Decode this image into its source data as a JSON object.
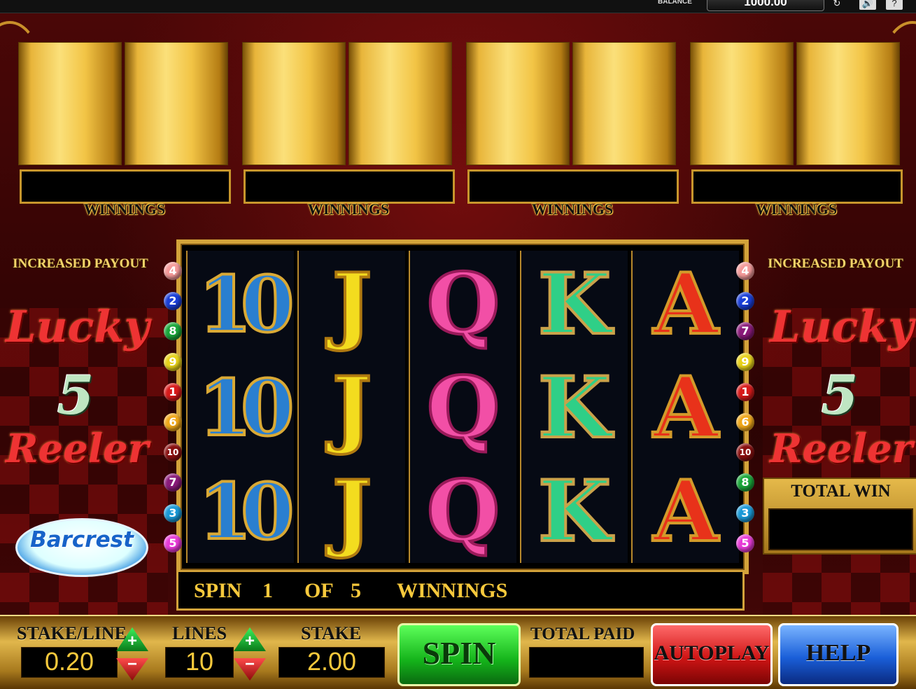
{
  "topbar": {
    "balance_label": "BALANCE",
    "balance_value": "1000.00",
    "refresh_icon": "↻",
    "sound_icon": "🔊",
    "help_icon": "?"
  },
  "bonus_reels": {
    "winnings_label": "WINNINGS",
    "count": 4
  },
  "side_left": {
    "title": "INCREASED PAYOUT",
    "lucky": "Lucky",
    "five": "5",
    "reeler": "Reeler"
  },
  "side_right": {
    "title": "INCREASED PAYOUT",
    "lucky": "Lucky",
    "five": "5",
    "reeler": "Reeler"
  },
  "brand": {
    "logo_text": "Barcrest"
  },
  "reels": [
    {
      "symbols": [
        "10",
        "10",
        "10"
      ],
      "class": "s10"
    },
    {
      "symbols": [
        "J",
        "J",
        "J"
      ],
      "class": "sJ"
    },
    {
      "symbols": [
        "Q",
        "Q",
        "Q"
      ],
      "class": "sQ"
    },
    {
      "symbols": [
        "K",
        "K",
        "K"
      ],
      "class": "sK"
    },
    {
      "symbols": [
        "A",
        "A",
        "A"
      ],
      "class": "sA"
    }
  ],
  "paylines_left": [
    {
      "n": "4",
      "color": "#f49a9a"
    },
    {
      "n": "2",
      "color": "#1a3fd8"
    },
    {
      "n": "8",
      "color": "#1aa83a"
    },
    {
      "n": "9",
      "color": "#e8d21a"
    },
    {
      "n": "1",
      "color": "#d81a1a"
    },
    {
      "n": "6",
      "color": "#f0a81a"
    },
    {
      "n": "10",
      "color": "#8a1010"
    },
    {
      "n": "7",
      "color": "#8a1a7a"
    },
    {
      "n": "3",
      "color": "#1a9ad8"
    },
    {
      "n": "5",
      "color": "#e83ad8"
    }
  ],
  "paylines_right": [
    {
      "n": "4",
      "color": "#f49a9a"
    },
    {
      "n": "2",
      "color": "#1a3fd8"
    },
    {
      "n": "7",
      "color": "#8a1a7a"
    },
    {
      "n": "9",
      "color": "#e8d21a"
    },
    {
      "n": "1",
      "color": "#d81a1a"
    },
    {
      "n": "6",
      "color": "#f0a81a"
    },
    {
      "n": "10",
      "color": "#8a1010"
    },
    {
      "n": "8",
      "color": "#1aa83a"
    },
    {
      "n": "3",
      "color": "#1a9ad8"
    },
    {
      "n": "5",
      "color": "#e83ad8"
    }
  ],
  "info": {
    "spin": "SPIN",
    "spin_num": "1",
    "of": "OF",
    "total": "5",
    "winnings": "WINNINGS"
  },
  "total_win": {
    "label": "TOTAL WIN",
    "value": ""
  },
  "controls": {
    "stake_line_label": "STAKE/LINE",
    "stake_line_value": "0.20",
    "lines_label": "LINES",
    "lines_value": "10",
    "stake_label": "STAKE",
    "stake_value": "2.00",
    "total_paid_label": "TOTAL PAID",
    "total_paid_value": "",
    "spin_label": "SPIN",
    "autoplay_label": "AUTOPLAY",
    "help_label": "HELP",
    "plus": "+",
    "minus": "−"
  }
}
